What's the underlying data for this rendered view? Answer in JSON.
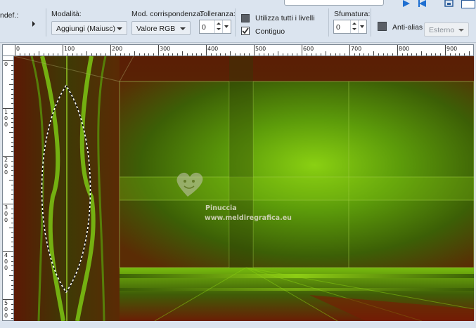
{
  "toolbar": {
    "preset_label": "ndef.:",
    "modalita_label": "Modalità:",
    "modalita_value": "Aggiungi (Maiusc)",
    "corrispondenza_label": "Mod. corrispondenza:",
    "corrispondenza_value": "Valore RGB",
    "tolleranza_label": "Tolleranza:",
    "tolleranza_value": "0",
    "usa_livelli_label": "Utilizza tutti i livelli",
    "contiguo_label": "Contiguo",
    "contiguo_checked": true,
    "sfumatura_label": "Sfumatura:",
    "sfumatura_value": "0",
    "antialias_label": "Anti-alias",
    "antialias_mode_value": "Esterno"
  },
  "ruler_h": [
    "0",
    "100",
    "200",
    "300",
    "400",
    "500",
    "600",
    "700",
    "800",
    "900"
  ],
  "ruler_v": [
    "0",
    "100",
    "200",
    "300",
    "400",
    "500"
  ],
  "watermark": {
    "line1": "Pinuccia",
    "line2": "www.meldiregrafica.eu"
  },
  "colors": {
    "toolbar_bg": "#dbe4ef",
    "canvas_green": "#5da10a",
    "canvas_red": "#6e1e05",
    "blue_icon": "#1f6fd1"
  },
  "icons": [
    "play-icon",
    "back-icon",
    "save-icon",
    "layout-icon"
  ]
}
